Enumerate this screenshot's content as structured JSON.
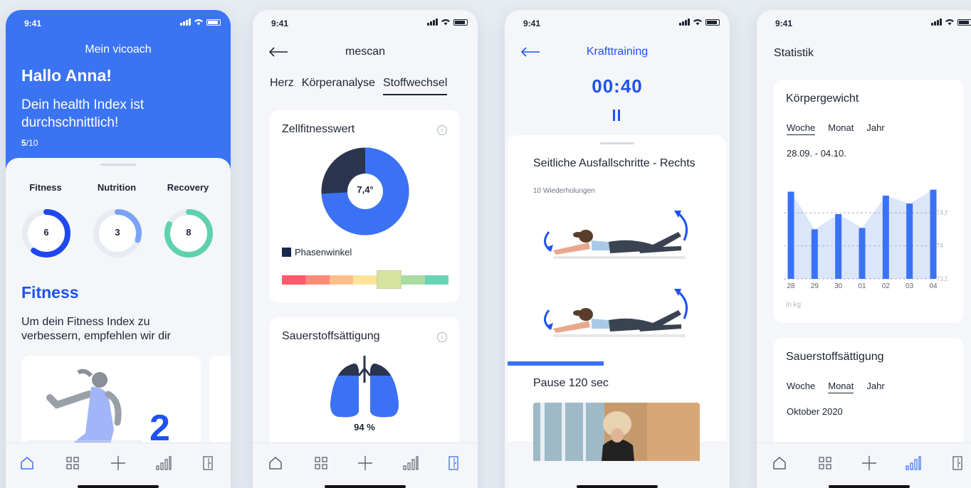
{
  "status_time": "9:41",
  "tabbar": {
    "icons": [
      "home-icon",
      "grid-icon",
      "plus-icon",
      "stats-icon",
      "door-icon"
    ]
  },
  "screen1": {
    "brand": "Mein vicoach",
    "greeting": "Hallo Anna!",
    "subtitle": "Dein health Index ist durchschnittlich!",
    "score_value": "5",
    "score_total": "/10",
    "rings": [
      {
        "label": "Fitness",
        "value": "6",
        "fraction": 0.6,
        "color": "#1f47f0"
      },
      {
        "label": "Nutrition",
        "value": "3",
        "fraction": 0.3,
        "color": "#7aa3f7"
      },
      {
        "label": "Recovery",
        "value": "8",
        "fraction": 0.82,
        "color": "#5fd2ad"
      }
    ],
    "section_title": "Fitness",
    "section_text": "Um dein Fitness Index zu verbessern, empfehlen wir dir",
    "card_number": "2"
  },
  "screen2": {
    "title": "mescan",
    "segments": [
      "Herz",
      "Körperanalyse",
      "Stoffwechsel"
    ],
    "active_segment": "Stoffwechsel",
    "card1_title": "Zellfitnesswert",
    "donut_value": "7,4°",
    "donut_fraction": 0.74,
    "legend_label": "Phasenwinkel",
    "scale_colors": [
      "#ff5a6e",
      "#ff8a7a",
      "#ffbf8c",
      "#ffe39a",
      "#d6e2a0",
      "#a9dba2",
      "#68d4b6"
    ],
    "scale_selected_index": 4,
    "card2_title": "Sauerstoffsättigung",
    "lung_value": "94 %",
    "info_icon": "i"
  },
  "screen3": {
    "title": "Krafttraining",
    "timer": "00:40",
    "exercise_title": "Seitliche Ausfallschritte - Rechts",
    "exercise_sub": "10 Wiederholungen",
    "pause_text": "Pause 120 sec",
    "progress_fraction": 0.45
  },
  "screen4": {
    "title": "Statistik",
    "card1_title": "Körpergewicht",
    "card1_tabs": [
      "Woche",
      "Monat",
      "Jahr"
    ],
    "card1_active": "Woche",
    "card1_range": "28.09. - 04.10.",
    "unit_label": "in kg",
    "card2_title": "Sauerstoffsättigung",
    "card2_tabs": [
      "Woche",
      "Monat",
      "Jahr"
    ],
    "card2_active": "Monat",
    "card2_range": "Oktober 2020"
  },
  "chart_data": {
    "type": "bar",
    "categories": [
      "28",
      "29",
      "30",
      "01",
      "02",
      "03",
      "04"
    ],
    "values": [
      74.82,
      74.25,
      74.48,
      74.27,
      74.76,
      74.64,
      74.85
    ],
    "yticks": [
      "74,5",
      "74",
      "73,5"
    ],
    "ylim": [
      73.5,
      74.9
    ],
    "ylabel": "in kg",
    "grid": true,
    "bar_color": "#3b72f5",
    "area_color": "#dbe6fb"
  }
}
